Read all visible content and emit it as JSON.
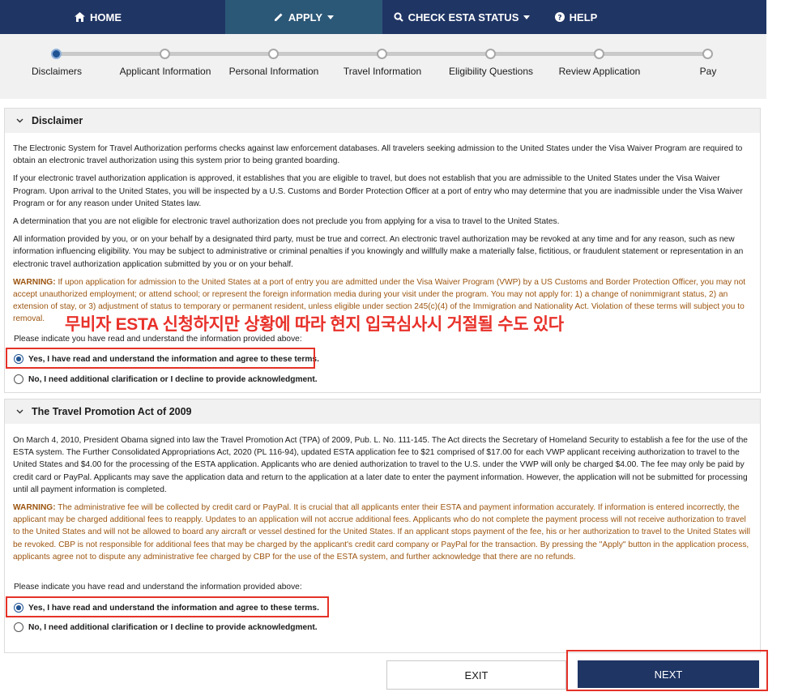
{
  "nav": {
    "home": "HOME",
    "apply": "APPLY",
    "check_status": "CHECK ESTA STATUS",
    "help": "HELP"
  },
  "steps": [
    "Disclaimers",
    "Applicant Information",
    "Personal Information",
    "Travel Information",
    "Eligibility Questions",
    "Review Application",
    "Pay"
  ],
  "disclaimer": {
    "title": "Disclaimer",
    "p1": "The Electronic System for Travel Authorization performs checks against law enforcement databases. All travelers seeking admission to the United States under the Visa Waiver Program are required to obtain an electronic travel authorization using this system prior to being granted boarding.",
    "p2": "If your electronic travel authorization application is approved, it establishes that you are eligible to travel, but does not establish that you are admissible to the United States under the Visa Waiver Program. Upon arrival to the United States, you will be inspected by a U.S. Customs and Border Protection Officer at a port of entry who may determine that you are inadmissible under the Visa Waiver Program or for any reason under United States law.",
    "p3": "A determination that you are not eligible for electronic travel authorization does not preclude you from applying for a visa to travel to the United States.",
    "p4": "All information provided by you, or on your behalf by a designated third party, must be true and correct. An electronic travel authorization may be revoked at any time and for any reason, such as new information influencing eligibility. You may be subject to administrative or criminal penalties if you knowingly and willfully make a materially false, fictitious, or fraudulent statement or representation in an electronic travel authorization application submitted by you or on your behalf.",
    "warning_label": "WARNING:",
    "warning_text": " If upon application for admission to the United States at a port of entry you are admitted under the Visa Waiver Program (VWP) by a US Customs and Border Protection Officer, you may not accept unauthorized employment; or attend school; or represent the foreign information media during your visit under the program. You may not apply for: 1) a change of nonimmigrant status, 2) an extension of stay, or 3) adjustment of status to temporary or permanent resident, unless eligible under section 245(c)(4) of the Immigration and Nationality Act. Violation of these terms will subject you to removal.",
    "prompt": "Please indicate you have read and understand the information provided above:",
    "option_yes": "Yes, I have read and understand the information and agree to these terms.",
    "option_no": "No, I need additional clarification or I decline to provide acknowledgment."
  },
  "annotation": "무비자 ESTA 신청하지만 상황에 따라 현지 입국심사시 거절될 수도 있다",
  "tpa": {
    "title": "The Travel Promotion Act of 2009",
    "p1": "On March 4, 2010, President Obama signed into law the Travel Promotion Act (TPA) of 2009, Pub. L. No. 111-145. The Act directs the Secretary of Homeland Security to establish a fee for the use of the ESTA system. The Further Consolidated Appropriations Act, 2020 (PL 116-94), updated ESTA application fee to $21 comprised of $17.00 for each VWP applicant receiving authorization to travel to the United States and $4.00 for the processing of the ESTA application. Applicants who are denied authorization to travel to the U.S. under the VWP will only be charged $4.00. The fee may only be paid by credit card or PayPal. Applicants may save the application data and return to the application at a later date to enter the payment information. However, the application will not be submitted for processing until all payment information is completed.",
    "warning_label": "WARNING:",
    "warning_text": " The administrative fee will be collected by credit card or PayPal. It is crucial that all applicants enter their ESTA and payment information accurately. If information is entered incorrectly, the applicant may be charged additional fees to reapply. Updates to an application will not accrue additional fees. Applicants who do not complete the payment process will not receive authorization to travel to the United States and will not be allowed to board any aircraft or vessel destined for the United States. If an applicant stops payment of the fee, his or her authorization to travel to the United States will be revoked. CBP is not responsible for additional fees that may be charged by the applicant's credit card company or PayPal for the transaction. By pressing the \"Apply\" button in the application process, applicants agree not to dispute any administrative fee charged by CBP for the use of the ESTA system, and further acknowledge that there are no refunds.",
    "prompt": "Please indicate you have read and understand the information provided above:",
    "option_yes": "Yes, I have read and understand the information and agree to these terms.",
    "option_no": "No, I need additional clarification or I decline to provide acknowledgment."
  },
  "buttons": {
    "exit": "EXIT",
    "next": "NEXT"
  },
  "colors": {
    "nav_bg": "#1f3564",
    "nav_active": "#2c5878",
    "warning_text": "#9c5510",
    "highlight": "#e53228"
  }
}
